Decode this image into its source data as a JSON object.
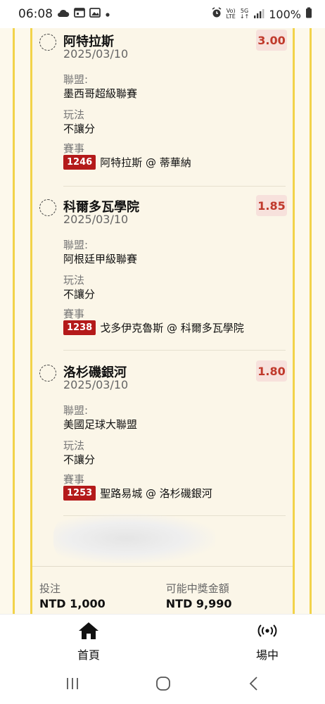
{
  "status_bar": {
    "time": "06:08",
    "network_top": "Vo)",
    "network_bottom": "LTE",
    "signal_top": "5G",
    "battery": "100%"
  },
  "bets": [
    {
      "team": "阿特拉斯",
      "date": "2025/03/10",
      "odds": "3.00",
      "league_label": "聯盟:",
      "league": "墨西哥超級聯賽",
      "play_label": "玩法",
      "play": "不讓分",
      "event_label": "賽事",
      "event_id": "1246",
      "event": "阿特拉斯 @ 蒂華納"
    },
    {
      "team": "科爾多瓦學院",
      "date": "2025/03/10",
      "odds": "1.85",
      "league_label": "聯盟:",
      "league": "阿根廷甲級聯賽",
      "play_label": "玩法",
      "play": "不讓分",
      "event_label": "賽事",
      "event_id": "1238",
      "event": "戈多伊克魯斯 @ 科爾多瓦學院"
    },
    {
      "team": "洛杉磯銀河",
      "date": "2025/03/10",
      "odds": "1.80",
      "league_label": "聯盟:",
      "league": "美國足球大聯盟",
      "play_label": "玩法",
      "play": "不讓分",
      "event_label": "賽事",
      "event_id": "1253",
      "event": "聖路易城 @ 洛杉磯銀河"
    }
  ],
  "totals": {
    "stake_label": "投注",
    "stake": "NTD 1,000",
    "payout_label": "可能中獎金額",
    "payout": "NTD 9,990"
  },
  "bottom_nav": {
    "home": "首頁",
    "live": "場中"
  },
  "colors": {
    "accent_yellow": "#f2d34a",
    "odds_red": "#c0392b",
    "event_badge": "#b41a1a"
  }
}
